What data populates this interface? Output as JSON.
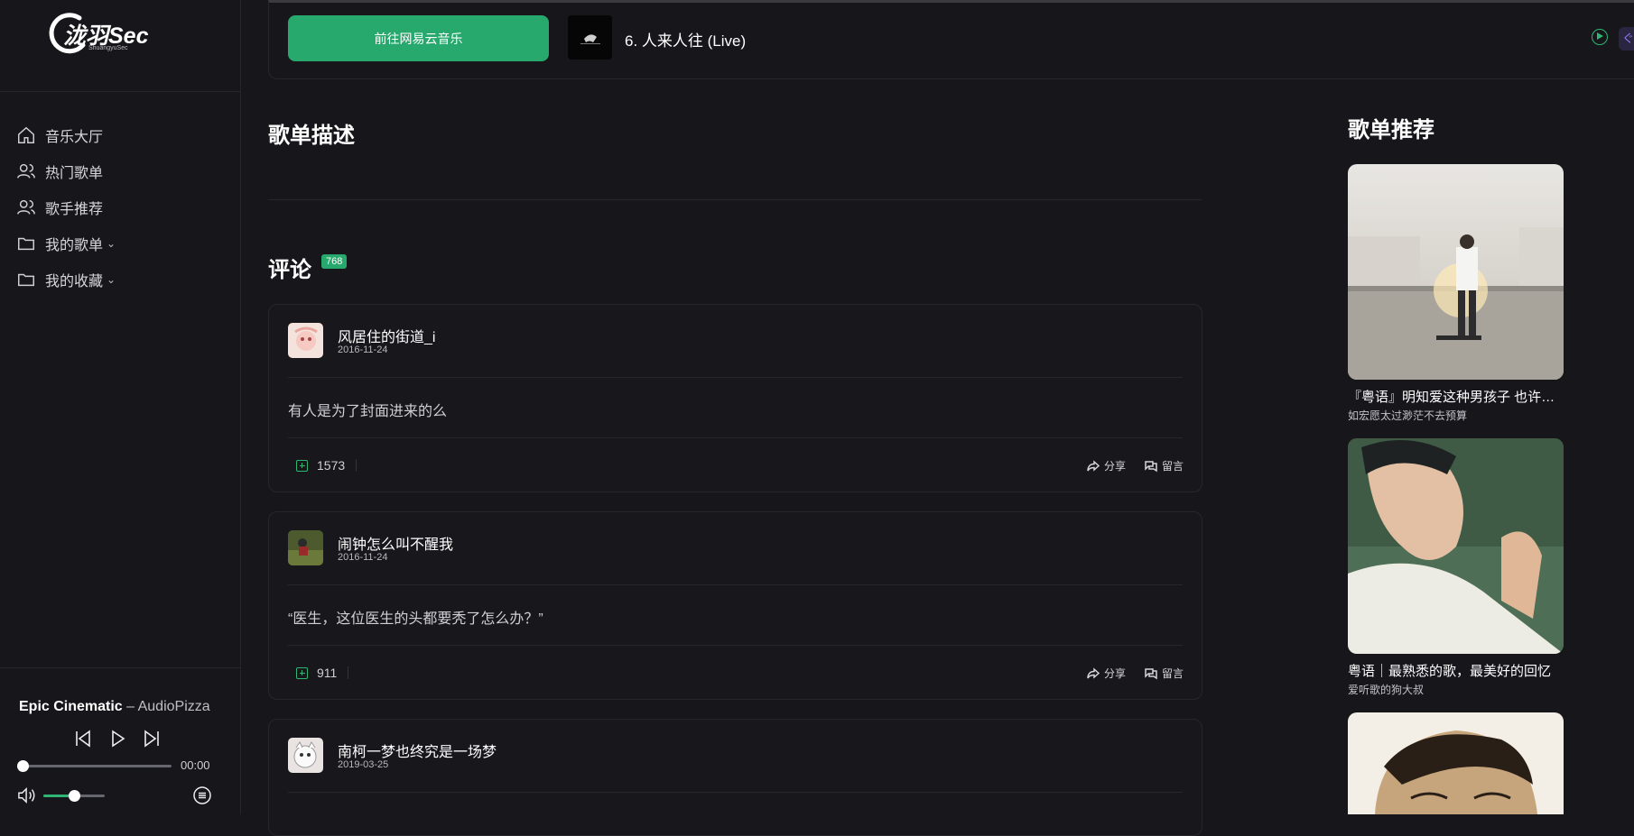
{
  "brand": {
    "name": "泷羽Sec",
    "sub": "ShuangyuSec"
  },
  "nav": [
    {
      "label": "音乐大厅",
      "icon": "home-icon"
    },
    {
      "label": "热门歌单",
      "icon": "users-icon"
    },
    {
      "label": "歌手推荐",
      "icon": "users-icon"
    },
    {
      "label": "我的歌单",
      "icon": "folder-icon",
      "caret": "⌄"
    },
    {
      "label": "我的收藏",
      "icon": "folder-icon",
      "caret": "⌄"
    }
  ],
  "player": {
    "track": "Epic Cinematic",
    "sep": " – ",
    "artist": "AudioPizza",
    "time": "00:00",
    "progress": 0,
    "volume": 0.5
  },
  "topbar": {
    "go_label": "前往网易云音乐",
    "current_track": "6. 人来人往 (Live)",
    "edge_chip": "ぐ"
  },
  "main": {
    "desc_title": "歌单描述",
    "comments_title": "评论",
    "comments_count": "768"
  },
  "comments": [
    {
      "user": "风居住的街道_i",
      "date": "2016-11-24",
      "text": "有人是为了封面进来的么",
      "likes": "1573",
      "share": "分享",
      "reply": "留言"
    },
    {
      "user": "闹钟怎么叫不醒我",
      "date": "2016-11-24",
      "text": "“医生，这位医生的头都要秃了怎么办？”",
      "likes": "911",
      "share": "分享",
      "reply": "留言"
    },
    {
      "user": "南柯一梦也终究是一场梦",
      "date": "2019-03-25",
      "text": "",
      "likes": "",
      "share": "",
      "reply": ""
    }
  ],
  "recommend": {
    "title": "歌单推荐",
    "items": [
      {
        "title": "『粤语』明知爱这种男孩子 也许只能终身遗憾",
        "creator": "如宏愿太过渺茫不去预算"
      },
      {
        "title": "粤语｜最熟悉的歌，最美好的回忆",
        "creator": "爱听歌的狗大叔"
      },
      {
        "title": "",
        "creator": ""
      }
    ]
  },
  "colors": {
    "accent": "#27a86c",
    "bg": "#16161b",
    "border": "#26262c"
  }
}
